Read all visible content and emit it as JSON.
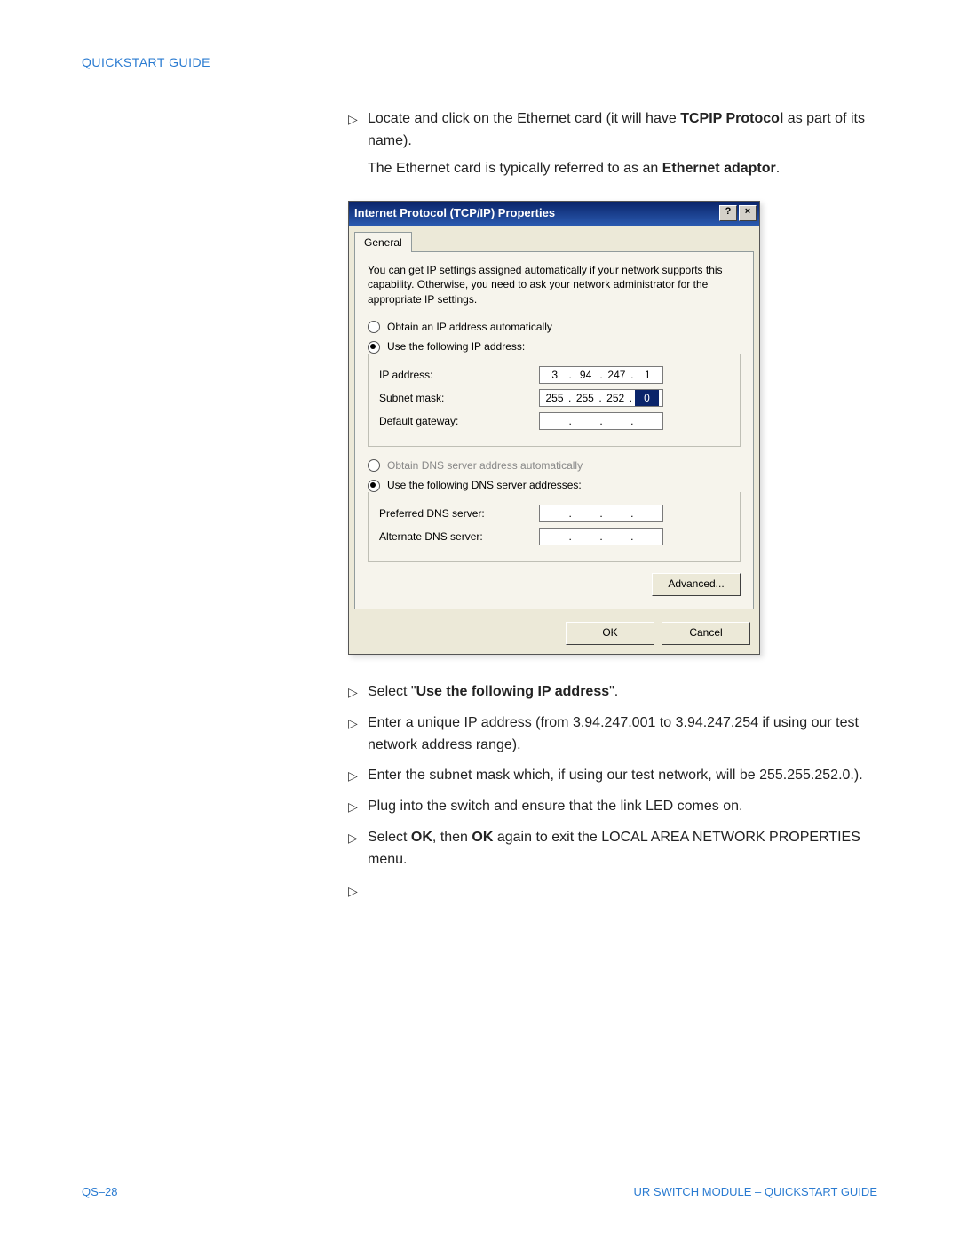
{
  "header": "QUICKSTART GUIDE",
  "intro": {
    "step1_pre": "Locate and click on the Ethernet card (it will have ",
    "step1_bold": "TCPIP Protocol",
    "step1_post": " as part of its name).",
    "note_pre": "The Ethernet card is typically referred to as an ",
    "note_bold": "Ethernet adaptor",
    "note_post": "."
  },
  "dialog": {
    "title": "Internet Protocol (TCP/IP) Properties",
    "help_btn": "?",
    "close_btn": "×",
    "tab": "General",
    "desc": "You can get IP settings assigned automatically if your network supports this capability. Otherwise, you need to ask your network administrator for the appropriate IP settings.",
    "radio_auto_ip": "Obtain an IP address automatically",
    "radio_use_ip": "Use the following IP address:",
    "lbl_ip": "IP address:",
    "lbl_mask": "Subnet mask:",
    "lbl_gw": "Default gateway:",
    "ip": {
      "a": "3",
      "b": "94",
      "c": "247",
      "d": "1"
    },
    "mask": {
      "a": "255",
      "b": "255",
      "c": "252",
      "d": "0"
    },
    "radio_auto_dns": "Obtain DNS server address automatically",
    "radio_use_dns": "Use the following DNS server addresses:",
    "lbl_pref_dns": "Preferred DNS server:",
    "lbl_alt_dns": "Alternate DNS server:",
    "btn_advanced": "Advanced...",
    "btn_ok": "OK",
    "btn_cancel": "Cancel"
  },
  "steps2": {
    "s1_pre": "Select \"",
    "s1_bold": "Use the following IP address",
    "s1_post": "\".",
    "s2": "Enter a unique IP address (from 3.94.247.001 to 3.94.247.254 if using our test network address range).",
    "s3": "Enter the subnet mask which, if using our test network, will be 255.255.252.0.).",
    "s4": "Plug into the switch and ensure that the link LED comes on.",
    "s5_pre": "Select ",
    "s5_b1": "OK",
    "s5_mid": ", then ",
    "s5_b2": "OK",
    "s5_post": " again to exit the LOCAL AREA NETWORK PROPERTIES menu."
  },
  "footer": {
    "left": "QS–28",
    "right": "UR SWITCH MODULE – QUICKSTART GUIDE"
  }
}
